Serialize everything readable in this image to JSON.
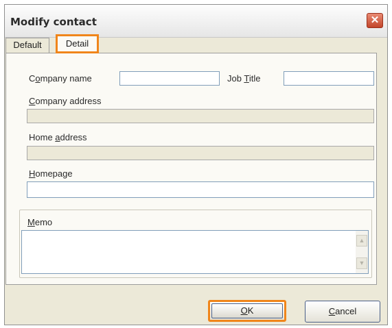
{
  "window": {
    "title": "Modify contact",
    "close_glyph": "✕"
  },
  "tabs": [
    {
      "label": "Default",
      "selected": false
    },
    {
      "label": "Detail",
      "selected": true
    }
  ],
  "fields": {
    "company_name": {
      "label_pre": "C",
      "label_u": "o",
      "label_post": "mpany name",
      "value": ""
    },
    "job_title": {
      "label_pre": "Job ",
      "label_u": "T",
      "label_post": "itle",
      "value": ""
    },
    "company_address": {
      "label_pre": "",
      "label_u": "C",
      "label_post": "ompany address",
      "value": ""
    },
    "home_address": {
      "label_pre": "Home ",
      "label_u": "a",
      "label_post": "ddress",
      "value": ""
    },
    "homepage": {
      "label_pre": "",
      "label_u": "H",
      "label_post": "omepage",
      "value": ""
    },
    "memo": {
      "label_pre": "",
      "label_u": "M",
      "label_post": "emo",
      "value": ""
    }
  },
  "buttons": {
    "ok": {
      "label_u": "O",
      "label_post": "K"
    },
    "cancel": {
      "label_u": "C",
      "label_post": "ancel"
    }
  },
  "icons": [
    "close-icon",
    "scroll-up-icon",
    "scroll-down-icon"
  ],
  "colors": {
    "highlight": "#f0851a",
    "dialog_bg": "#ece9d8",
    "close_red": "#c2452a"
  }
}
